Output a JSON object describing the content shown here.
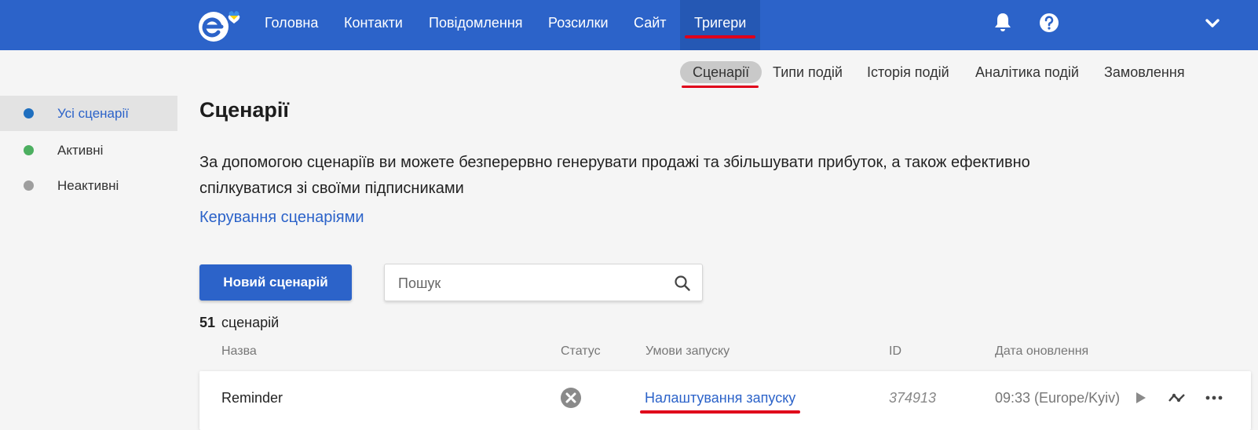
{
  "header": {
    "nav": [
      "Головна",
      "Контакти",
      "Повідомлення",
      "Розсилки",
      "Сайт",
      "Тригери"
    ],
    "active_nav": "Тригери",
    "icons": [
      "bell-icon",
      "help-icon",
      "chevron-down-icon"
    ],
    "brand_color": "#2c63c9"
  },
  "subnav": {
    "items": [
      "Сценарії",
      "Типи подій",
      "Історія подій",
      "Аналітика подій",
      "Замовлення"
    ],
    "active": "Сценарії"
  },
  "sidebar": {
    "items": [
      {
        "label": "Усі сценарії",
        "dot_color": "#1f6fbf",
        "active": true
      },
      {
        "label": "Активні",
        "dot_color": "#4caf60",
        "active": false
      },
      {
        "label": "Неактивні",
        "dot_color": "#9e9e9e",
        "active": false
      }
    ]
  },
  "main": {
    "title": "Сценарії",
    "description": "За допомогою сценаріїв ви можете безперервно генерувати продажі та збільшувати прибуток, а також ефективно спілкуватися зі своїми підписниками",
    "manage_link": "Керування сценаріями",
    "new_button": "Новий сценарій",
    "search_placeholder": "Пошук",
    "count_number": "51",
    "count_label": "сценарій"
  },
  "table": {
    "headers": [
      "Назва",
      "Статус",
      "Умови запуску",
      "ID",
      "Дата оновлення"
    ],
    "rows": [
      {
        "name": "Reminder",
        "status_icon": "disabled-status-icon",
        "trigger_link": "Налаштування запуску",
        "id": "374913",
        "updated": "09:33 (Europe/Kyiv)",
        "actions": [
          "play-icon",
          "analytics-icon",
          "more-icon"
        ]
      }
    ]
  }
}
